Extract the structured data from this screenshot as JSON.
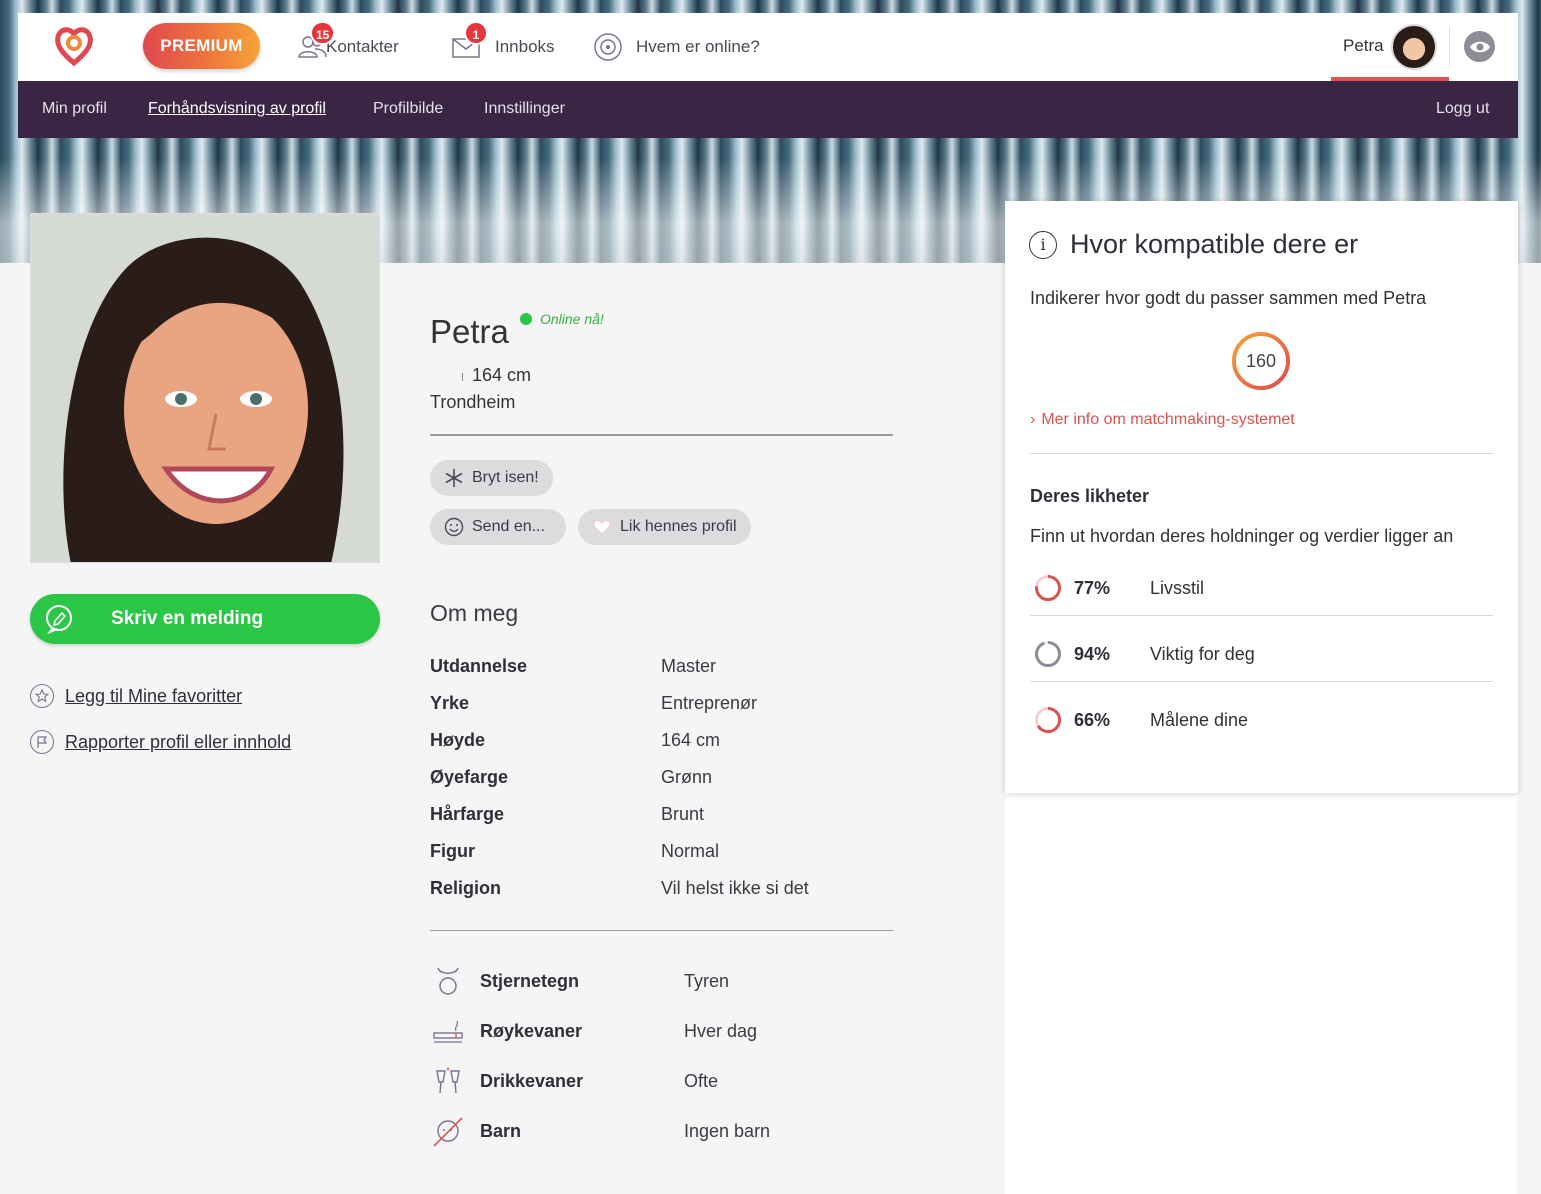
{
  "topbar": {
    "premium_label": "PREMIUM",
    "contacts_label": "Kontakter",
    "contacts_badge": "15",
    "inbox_label": "Innboks",
    "inbox_badge": "1",
    "online_label": "Hvem er online?",
    "user_name": "Petra"
  },
  "subnav": {
    "items": [
      "Min profil",
      "Forhåndsvisning av profil",
      "Profilbilde",
      "Innstillinger"
    ],
    "logout": "Logg ut"
  },
  "profile": {
    "name": "Petra",
    "online_status": "Online nå!",
    "height": "164 cm",
    "city": "Trondheim",
    "icebreaker": "Bryt isen!",
    "send": "Send en...",
    "like": "Lik hennes profil",
    "write_message": "Skriv en melding",
    "add_favorite": "Legg til Mine favoritter",
    "report": "Rapporter profil eller innhold"
  },
  "about": {
    "title": "Om meg",
    "facts": [
      {
        "label": "Utdannelse",
        "value": "Master"
      },
      {
        "label": "Yrke",
        "value": "Entreprenør"
      },
      {
        "label": "Høyde",
        "value": "164 cm"
      },
      {
        "label": "Øyefarge",
        "value": "Grønn"
      },
      {
        "label": "Hårfarge",
        "value": "Brunt"
      },
      {
        "label": "Figur",
        "value": "Normal"
      },
      {
        "label": "Religion",
        "value": "Vil helst ikke si det"
      }
    ],
    "habits": [
      {
        "icon": "taurus-icon",
        "label": "Stjernetegn",
        "value": "Tyren"
      },
      {
        "icon": "cigarette-icon",
        "label": "Røykevaner",
        "value": "Hver dag"
      },
      {
        "icon": "champagne-icon",
        "label": "Drikkevaner",
        "value": "Ofte"
      },
      {
        "icon": "no-children-icon",
        "label": "Barn",
        "value": "Ingen barn"
      }
    ]
  },
  "compatibility": {
    "title": "Hvor kompatible dere er",
    "subtitle": "Indikerer hvor godt du passer sammen med Petra",
    "score": "160",
    "more_info": "Mer info om matchmaking-systemet",
    "likeness_title": "Deres likheter",
    "likeness_subtitle": "Finn ut hvordan deres holdninger og verdier ligger an",
    "items": [
      {
        "percent": "77%",
        "label": "Livsstil",
        "color": "#d9534f"
      },
      {
        "percent": "94%",
        "label": "Viktig for deg",
        "color": "#8d8d97"
      },
      {
        "percent": "66%",
        "label": "Målene dine",
        "color": "#d9534f"
      }
    ]
  },
  "colors": {
    "accent": "#d9534f",
    "subnav_bg": "#3b2545",
    "green": "#2bc646"
  }
}
